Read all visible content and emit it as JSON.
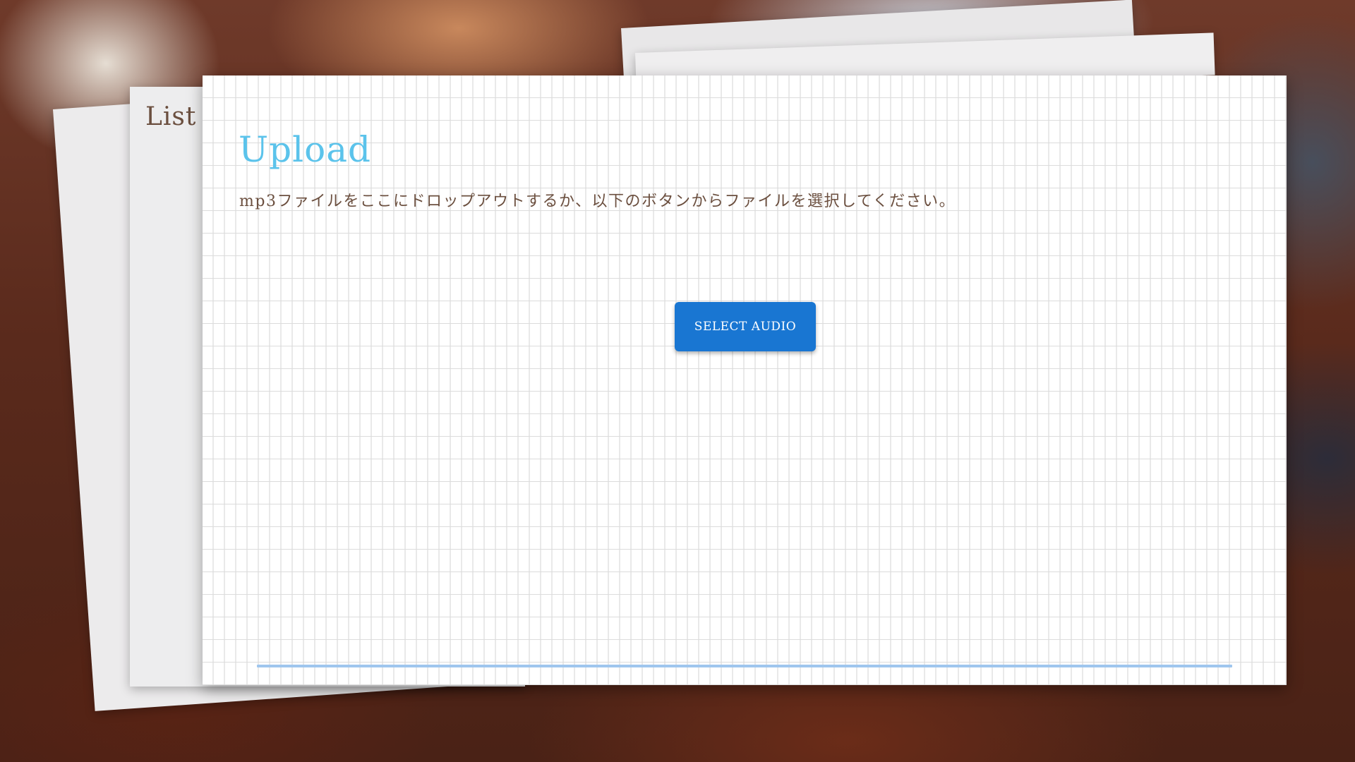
{
  "list_sheet": {
    "title": "List"
  },
  "upload_card": {
    "title": "Upload",
    "instruction": "mp3ファイルをここにドロップアウトするか、以下のボタンからファイルを選択してください。",
    "select_button_label": "SELECT AUDIO",
    "progress": 0
  },
  "colors": {
    "title_accent": "#5bc3eb",
    "button": "#1976d2",
    "text_brown": "#6b4f3f",
    "progress_track": "#9fc6ee"
  }
}
